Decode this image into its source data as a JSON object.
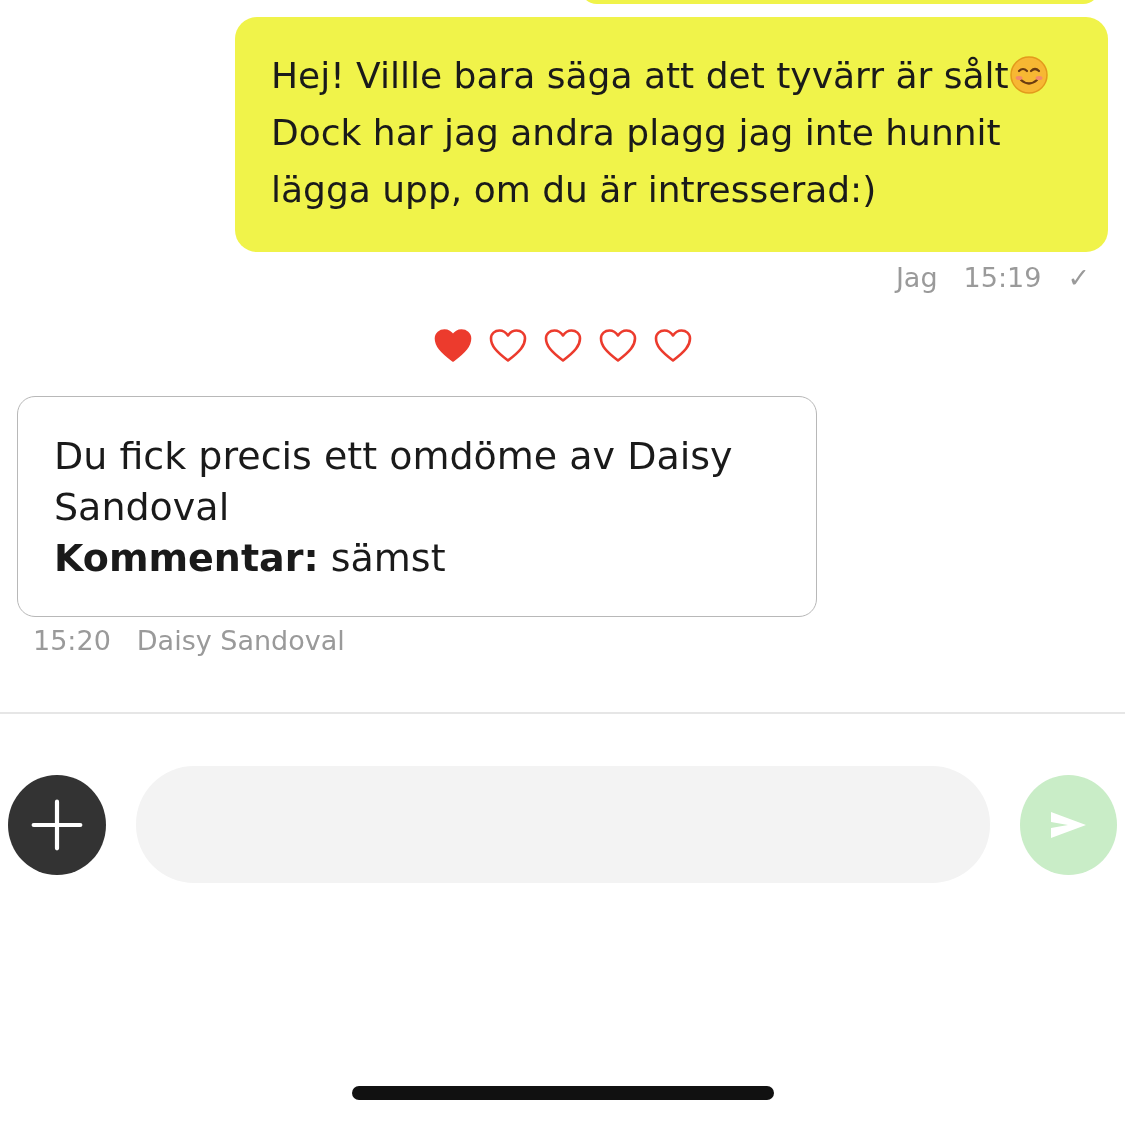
{
  "messages": [
    {
      "kind": "outgoing",
      "text_before": "Hej! Villle bara säga att det tyvärr är sålt",
      "text_after": " Dock har jag andra plagg jag inte hunnit lägga upp, om du är intresserad:)",
      "sender": "Jag",
      "time": "15:19",
      "status": "✓"
    }
  ],
  "rating": {
    "stars": 1
  },
  "review": {
    "text": "Du fick precis ett omdöme av Daisy Sandoval",
    "comment": "**Kommentar:** sämst",
    "time": "15:20",
    "sender": "Daisy Sandoval"
  },
  "composer": {
    "send_enabled": false
  }
}
